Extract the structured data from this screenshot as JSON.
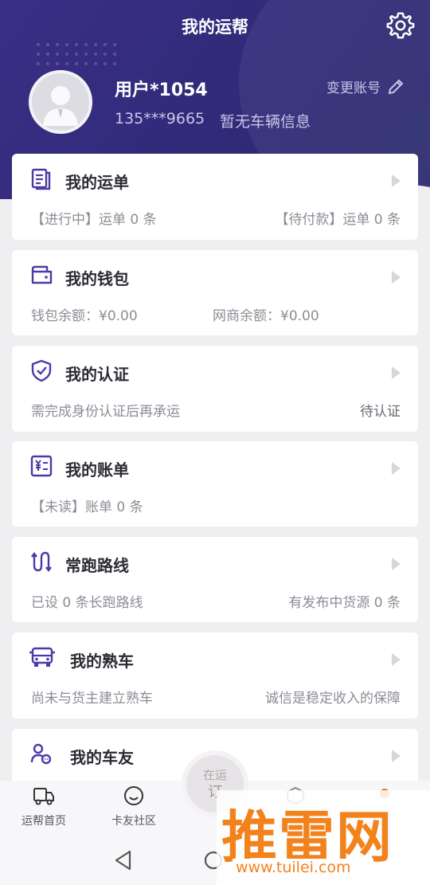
{
  "header": {
    "title": "我的运帮",
    "username": "用户*1054",
    "phone": "135***9665",
    "vehicle_info": "暂无车辆信息",
    "change_account": "变更账号"
  },
  "cards": {
    "waybill": {
      "title": "我的运单",
      "left": "【进行中】运单 0 条",
      "right": "【待付款】运单 0 条"
    },
    "wallet": {
      "title": "我的钱包",
      "left": "钱包余额：¥0.00",
      "mid": "网商余额：¥0.00"
    },
    "auth": {
      "title": "我的认证",
      "left": "需完成身份认证后再承运",
      "right": "待认证"
    },
    "bill": {
      "title": "我的账单",
      "left": "【未读】账单 0 条"
    },
    "route": {
      "title": "常跑路线",
      "left": "已设 0 条长跑路线",
      "right": "有发布中货源 0 条"
    },
    "familiar_car": {
      "title": "我的熟车",
      "left": "尚未与货主建立熟车",
      "right": "诚信是稳定收入的保障"
    },
    "car_friends": {
      "title": "我的车友"
    }
  },
  "tabbar": {
    "home": "运帮首页",
    "community": "卡友社区",
    "center_line1": "在运",
    "center_line2": "订"
  },
  "watermark": {
    "text": "推雷网",
    "url": "www.tuilei.com"
  },
  "colors": {
    "header": "#302a78",
    "accent": "#4a3ca8",
    "watermark": "#f2821b"
  }
}
